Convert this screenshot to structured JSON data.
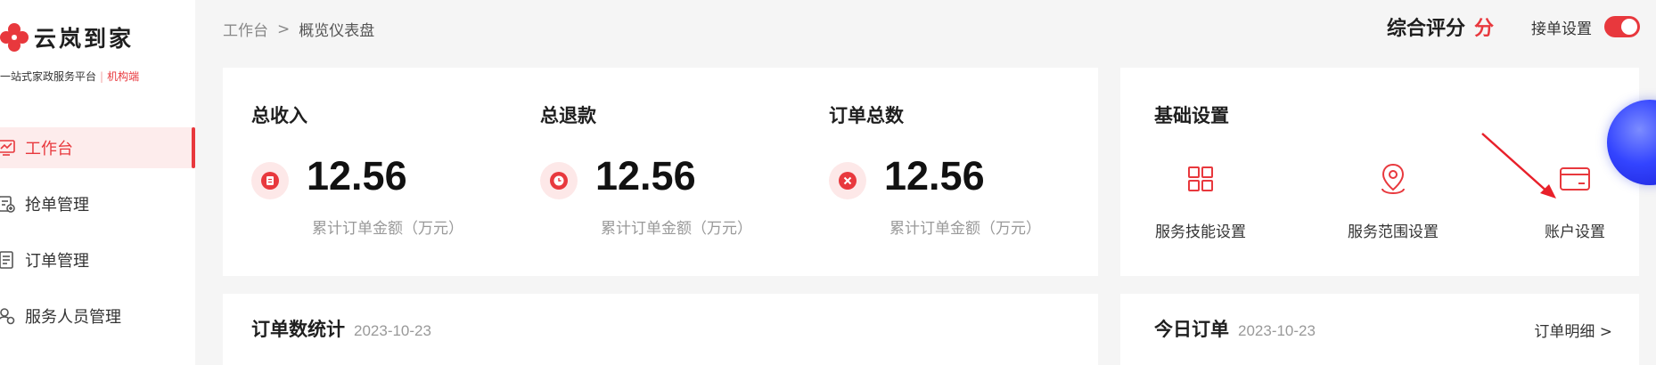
{
  "brand": {
    "name": "云岚到家",
    "tagline": "一站式家政服务平台",
    "separator": "|",
    "role": "机构端",
    "accent_color": "#e8383d"
  },
  "sidebar": {
    "items": [
      {
        "label": "工作台",
        "icon": "dashboard-icon",
        "active": true
      },
      {
        "label": "抢单管理",
        "icon": "grab-order-icon",
        "active": false
      },
      {
        "label": "订单管理",
        "icon": "order-list-icon",
        "active": false
      },
      {
        "label": "服务人员管理",
        "icon": "staff-icon",
        "active": false
      }
    ]
  },
  "breadcrumb": {
    "root": "工作台",
    "separator": ">",
    "current": "概览仪表盘"
  },
  "header": {
    "rating_label": "综合评分",
    "rating_unit": "分",
    "accept_label": "接单设置",
    "accept_enabled": true
  },
  "stats": [
    {
      "title": "总收入",
      "value": "12.56",
      "sub": "累计订单金额（万元）",
      "icon": "income-icon"
    },
    {
      "title": "总退款",
      "value": "12.56",
      "sub": "累计订单金额（万元）",
      "icon": "refund-icon"
    },
    {
      "title": "订单总数",
      "value": "12.56",
      "sub": "累计订单金额（万元）",
      "icon": "order-total-icon"
    }
  ],
  "basic_settings": {
    "title": "基础设置",
    "items": [
      {
        "label": "服务技能设置",
        "icon": "grid-icon"
      },
      {
        "label": "服务范围设置",
        "icon": "location-pin-icon"
      },
      {
        "label": "账户设置",
        "icon": "credit-card-icon"
      }
    ]
  },
  "order_stats": {
    "title": "订单数统计",
    "date": "2023-10-23"
  },
  "today_orders": {
    "title": "今日订单",
    "date": "2023-10-23",
    "detail_link": "订单明细 >"
  }
}
